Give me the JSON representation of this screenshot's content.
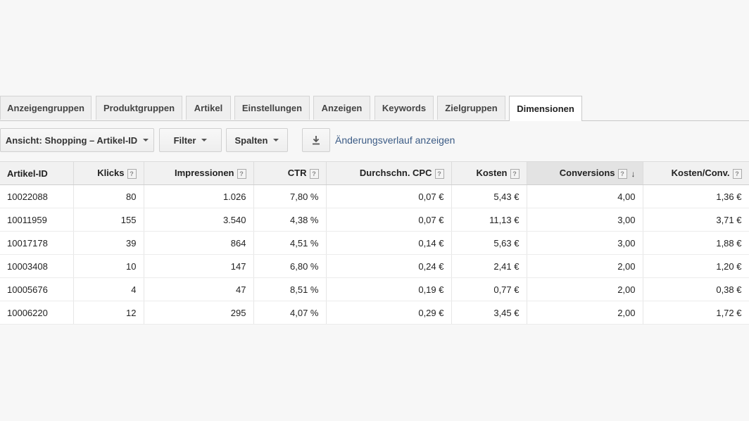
{
  "tabs": [
    {
      "label": "Anzeigengruppen",
      "active": false
    },
    {
      "label": "Produktgruppen",
      "active": false
    },
    {
      "label": "Artikel",
      "active": false
    },
    {
      "label": "Einstellungen",
      "active": false
    },
    {
      "label": "Anzeigen",
      "active": false
    },
    {
      "label": "Keywords",
      "active": false
    },
    {
      "label": "Zielgruppen",
      "active": false
    },
    {
      "label": "Dimensionen",
      "active": true
    }
  ],
  "toolbar": {
    "view_label": "Ansicht: Shopping – Artikel-ID",
    "filter_label": "Filter",
    "columns_label": "Spalten",
    "download_icon": "download-icon",
    "history_label": "Änderungsverlauf anzeigen"
  },
  "table": {
    "sorted_column": "Conversions",
    "sort_direction": "descending",
    "columns": [
      "Artikel-ID",
      "Klicks",
      "Impressionen",
      "CTR",
      "Durchschn. CPC",
      "Kosten",
      "Conversions",
      "Kosten/Conv."
    ],
    "help_marker": "?",
    "rows": [
      [
        "10022088",
        "80",
        "1.026",
        "7,80 %",
        "0,07 €",
        "5,43 €",
        "4,00",
        "1,36 €"
      ],
      [
        "10011959",
        "155",
        "3.540",
        "4,38 %",
        "0,07 €",
        "11,13 €",
        "3,00",
        "3,71 €"
      ],
      [
        "10017178",
        "39",
        "864",
        "4,51 %",
        "0,14 €",
        "5,63 €",
        "3,00",
        "1,88 €"
      ],
      [
        "10003408",
        "10",
        "147",
        "6,80 %",
        "0,24 €",
        "2,41 €",
        "2,00",
        "1,20 €"
      ],
      [
        "10005676",
        "4",
        "47",
        "8,51 %",
        "0,19 €",
        "0,77 €",
        "2,00",
        "0,38 €"
      ],
      [
        "10006220",
        "12",
        "295",
        "4,07 %",
        "0,29 €",
        "3,45 €",
        "2,00",
        "1,72 €"
      ]
    ]
  }
}
